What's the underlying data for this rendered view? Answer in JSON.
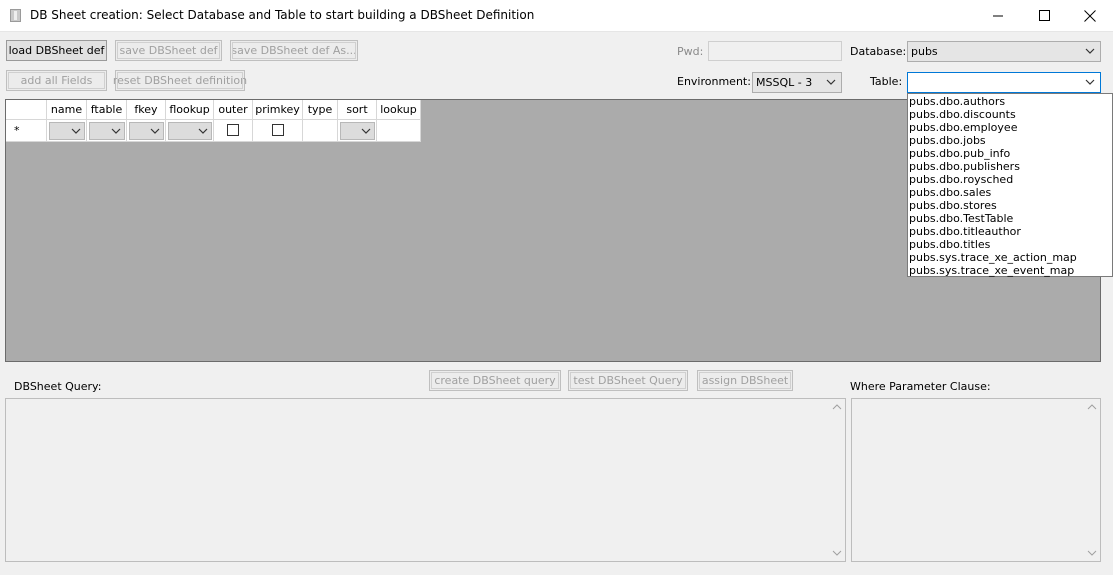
{
  "window": {
    "title": "DB Sheet creation: Select Database and Table to start building a DBSheet Definition"
  },
  "toolbar": {
    "load_label": "load DBSheet def",
    "save_label": "save DBSheet def",
    "save_as_label": "save DBSheet def As...",
    "add_all_label": "add all Fields",
    "reset_label": "reset DBSheet definition"
  },
  "connection": {
    "pwd_label": "Pwd:",
    "pwd_value": "",
    "environment_label": "Environment:",
    "environment_value": "MSSQL - 3",
    "database_label": "Database:",
    "database_value": "pubs",
    "table_label": "Table:",
    "table_value": ""
  },
  "grid": {
    "columns": [
      "name",
      "ftable",
      "fkey",
      "flookup",
      "outer",
      "primkey",
      "type",
      "sort",
      "lookup"
    ],
    "new_row_marker": "*"
  },
  "table_options": [
    "pubs.dbo.authors",
    "pubs.dbo.discounts",
    "pubs.dbo.employee",
    "pubs.dbo.jobs",
    "pubs.dbo.pub_info",
    "pubs.dbo.publishers",
    "pubs.dbo.roysched",
    "pubs.dbo.sales",
    "pubs.dbo.stores",
    "pubs.dbo.TestTable",
    "pubs.dbo.titleauthor",
    "pubs.dbo.titles",
    "pubs.sys.trace_xe_action_map",
    "pubs.sys.trace_xe_event_map"
  ],
  "query": {
    "query_label": "DBSheet Query:",
    "create_label": "create DBSheet query",
    "test_label": "test DBSheet Query",
    "assign_label": "assign DBSheet",
    "where_label": "Where Parameter Clause:",
    "query_text": "",
    "where_text": ""
  },
  "icons": {
    "app": "app-icon",
    "minimize": "minimize-icon",
    "maximize": "maximize-icon",
    "close": "close-icon",
    "dropdown": "chevron-down-icon"
  }
}
